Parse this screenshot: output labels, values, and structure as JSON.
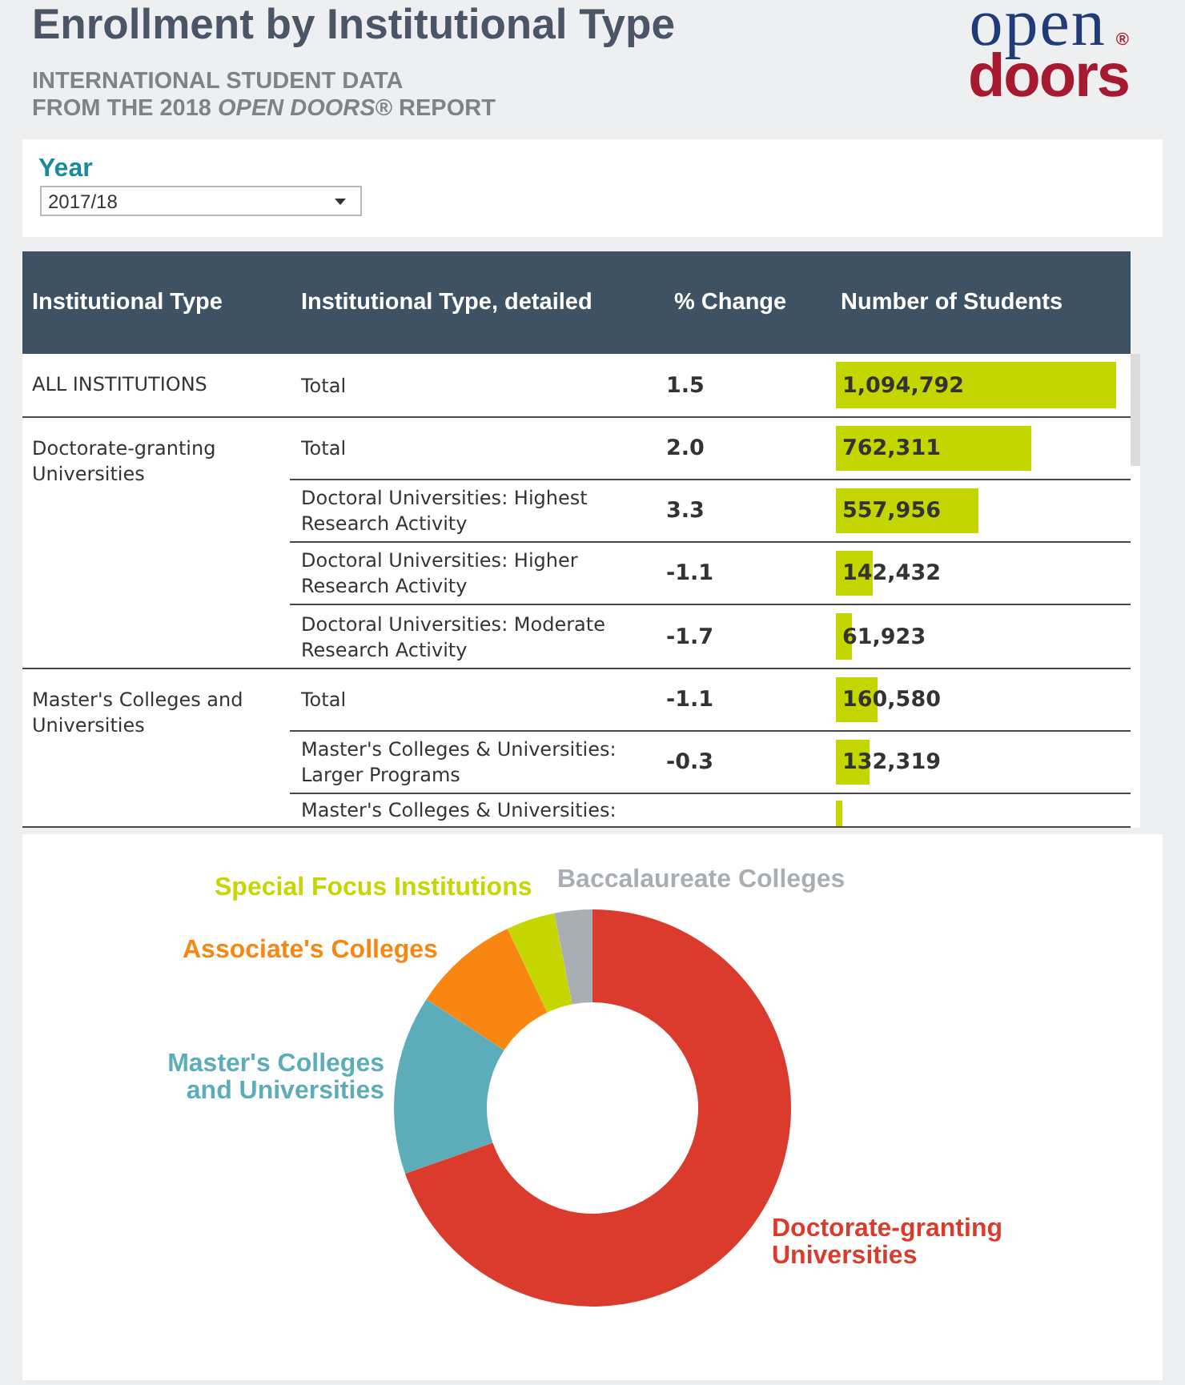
{
  "header": {
    "title": "Enrollment by Institutional Type",
    "subtitle_lines": [
      "INTERNATIONAL STUDENT DATA",
      "FROM THE 2018 *OPEN DOORS*® REPORT"
    ],
    "logo": {
      "upper_word": "open",
      "lower_word": "doors",
      "mark": "®"
    }
  },
  "year_filter": {
    "label": "Year",
    "value": "2017/18"
  },
  "table": {
    "columns": [
      "Institutional Type",
      "Institutional Type, detailed",
      "% Change",
      "Number of Students"
    ],
    "groups": [
      {
        "institutional_type": "ALL INSTITUTIONS",
        "rows": [
          {
            "institutional_type_detailed": "Total",
            "percent_change": "1.5",
            "number_of_students": "1,094,792",
            "level": 0.972
          }
        ]
      },
      {
        "institutional_type": "Doctorate-granting Universities",
        "rows": [
          {
            "institutional_type_detailed": "Total",
            "percent_change": "2.0",
            "number_of_students": "762,311",
            "level": 0.678
          },
          {
            "institutional_type_detailed": "Doctoral Universities: Highest Research Activity",
            "percent_change": "3.3",
            "number_of_students": "557,956",
            "level": 0.495
          },
          {
            "institutional_type_detailed": "Doctoral Universities: Higher Research Activity",
            "percent_change": "-1.1",
            "number_of_students": "142,432",
            "level": 0.126
          },
          {
            "institutional_type_detailed": "Doctoral Universities: Moderate Research Activity",
            "percent_change": "-1.7",
            "number_of_students": "61,923",
            "level": 0.055
          }
        ]
      },
      {
        "institutional_type": "Master's Colleges and Universities",
        "rows": [
          {
            "institutional_type_detailed": "Total",
            "percent_change": "-1.1",
            "number_of_students": "160,580",
            "level": 0.143
          },
          {
            "institutional_type_detailed": "Master's Colleges & Universities: Larger Programs",
            "percent_change": "-0.3",
            "number_of_students": "132,319",
            "level": 0.117
          },
          {
            "institutional_type_detailed": "Master's Colleges & Universities:",
            "level": 0.02
          }
        ]
      }
    ]
  },
  "chart": {
    "slices": [
      {
        "label": "Special Focus Institutions",
        "color": "#c5d600"
      },
      {
        "label": "Baccalaureate Colleges",
        "color": "#a9aeb3"
      },
      {
        "label": "Associate's Colleges",
        "color": "#f98611"
      },
      {
        "label": "Master's Colleges and Universities",
        "color": "#5cadb9"
      },
      {
        "label": "Doctorate-granting Universities",
        "color": "#db3b2c"
      }
    ]
  }
}
